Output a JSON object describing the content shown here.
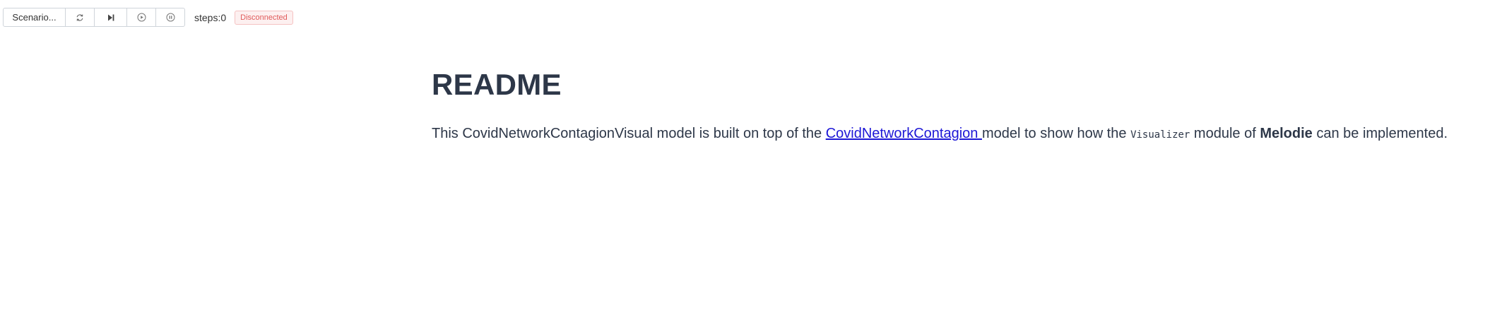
{
  "toolbar": {
    "scenario_label": "Scenario...",
    "reset_icon": "refresh-icon",
    "step_icon": "step-forward-icon",
    "run_icon": "play-circle-icon",
    "pause_icon": "pause-circle-icon",
    "steps_text": "steps:0",
    "status_text": "Disconnected"
  },
  "readme": {
    "title": "README",
    "text_1": "This CovidNetworkContagionVisual model is built on top of the ",
    "link_text": "CovidNetworkContagion ",
    "text_2": "model to show how the ",
    "code_text": "Visualizer",
    "text_3": " module of ",
    "bold_text": "Melodie",
    "text_4": " can be implemented."
  },
  "colors": {
    "link": "#1d17d6",
    "heading": "#2d3748",
    "status_text": "#e05a5a",
    "status_bg": "#fdf0f0"
  }
}
